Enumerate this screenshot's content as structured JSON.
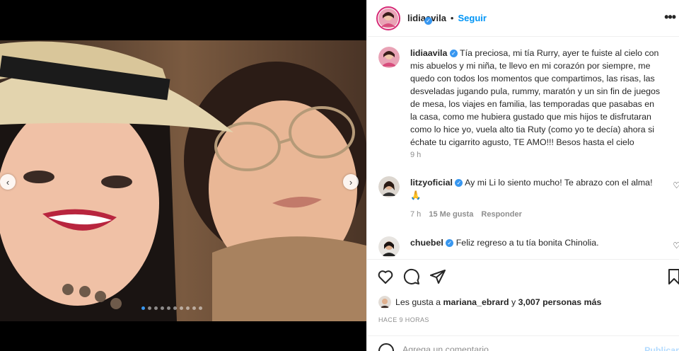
{
  "post": {
    "username": "lidiaavila",
    "follow_label": "Seguir",
    "bullet": "•",
    "more_label": "•••",
    "carousel": {
      "dot_count": 10,
      "active_index": 0
    }
  },
  "caption": {
    "username": "lidiaavila",
    "text": "Tía preciosa, mi tía Rurry, ayer te fuiste al cielo con mis abuelos y mi niña, te llevo en mi corazón por siempre, me quedo con todos los momentos que compartimos, las risas, las desveladas jugando pula, rummy, maratón y un sin fin de juegos de mesa, los viajes en familia, las temporadas que pasabas en la casa, como me hubiera gustado que mis hijos te disfrutaran como lo hice yo, vuela alto tia Ruty (como yo te decía) ahora si échate tu cigarrito agusto, TE AMO!!! Besos hasta el cielo",
    "time": "9 h"
  },
  "comments": [
    {
      "username": "litzyoficial",
      "text": "Ay mi Li lo siento mucho! Te abrazo con el alma!",
      "emoji": "🙏",
      "time": "7 h",
      "likes": "15 Me gusta",
      "reply_label": "Responder"
    },
    {
      "username": "chuebel",
      "text": "Feliz regreso a tu tía bonita Chinolia."
    }
  ],
  "likes": {
    "prefix": "Les gusta a",
    "user": "mariana_ebrard",
    "connector": "y",
    "others": "3,007 personas más"
  },
  "timestamp": "HACE 9 HORAS",
  "add_comment": {
    "placeholder": "Agrega un comentario...",
    "publish_label": "Publicar"
  },
  "colors": {
    "link": "#0095f6",
    "verified": "#3897f0",
    "muted": "#8e8e8e",
    "text": "#262626"
  }
}
